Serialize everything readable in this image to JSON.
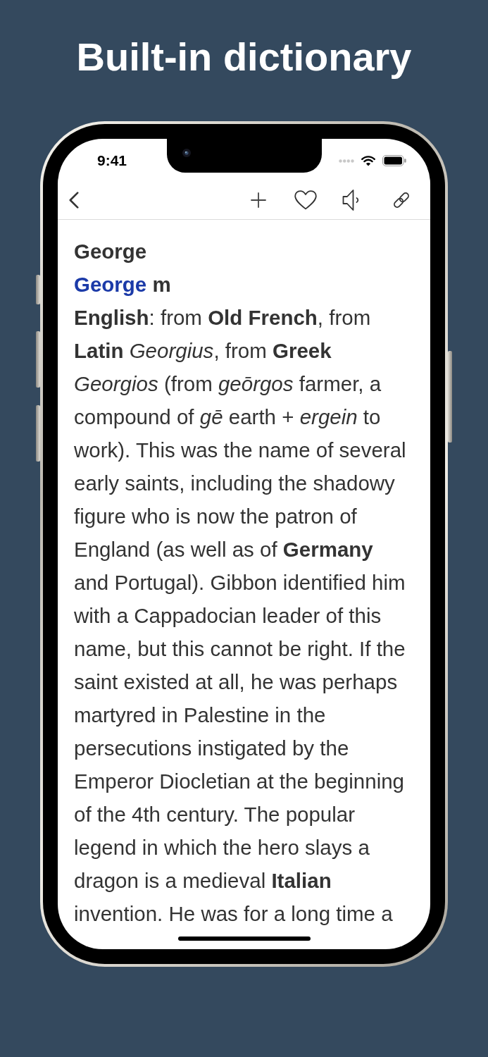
{
  "headline": "Built-in dictionary",
  "status_bar": {
    "time": "9:41"
  },
  "toolbar": {
    "favorite": false
  },
  "entry": {
    "title": "George",
    "headword": "George",
    "gender": "m",
    "definition": "**English**: from **Old French**, from **Latin** *Georgius*, from **Greek** *Georgios* (from *geōrgos* farmer, a compound of *gē* earth + *ergein* to work). This was the name of several early saints, including the shadowy figure who is now the patron of England (as well as of **Germany** and Portugal). Gibbon identified him with a Cappadocian leader of this name, but this cannot be right. If the saint existed at all, he was perhaps martyred in Palestine in the persecutions instigated by the Emperor Diocletian at the beginning of the 4th century. The popular legend in which the hero slays a dragon is a medieval **Italian** invention. He was for a long time a"
  }
}
